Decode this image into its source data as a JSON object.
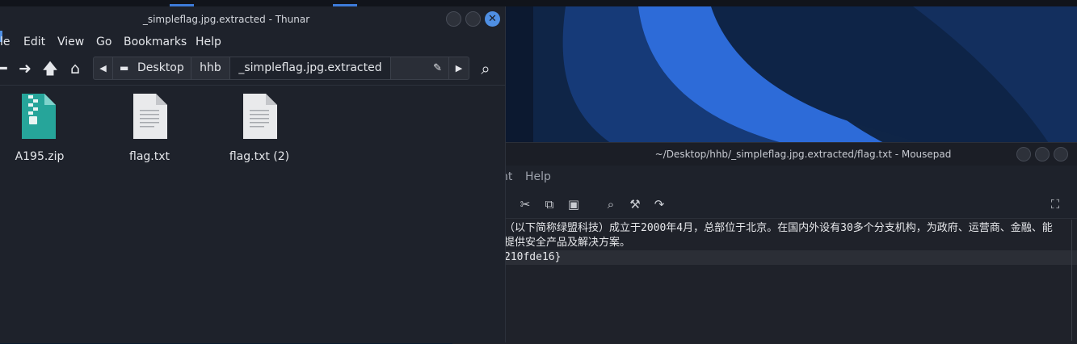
{
  "thunar": {
    "title": "_simpleflag.jpg.extracted - Thunar",
    "menu": [
      "le",
      "Edit",
      "View",
      "Go",
      "Bookmarks",
      "Help"
    ],
    "path": [
      "Desktop",
      "hhb",
      "_simpleflag.jpg.extracted"
    ],
    "files": [
      {
        "name": "A195.zip",
        "icon": "archive-zip-icon"
      },
      {
        "name": "flag.txt",
        "icon": "text-file-icon"
      },
      {
        "name": "flag.txt (2)",
        "icon": "text-file-icon"
      }
    ]
  },
  "mousepad": {
    "title": "~/Desktop/hhb/_simpleflag.jpg.extracted/flag.txt - Mousepad",
    "menu": [
      "nt",
      "Help"
    ],
    "lines": [
      "（以下简称绿盟科技）成立于2000年4月，总部位于北京。在国内外设有30多个分支机构，为政府、运营商、金融、能",
      "提供安全产品及解决方案。",
      "210fde16}"
    ]
  },
  "colors": {
    "accent": "#4f8fe3",
    "window_bg": "#1e222b",
    "wallpaper_dark": "#0d1b2e",
    "wallpaper_blue": "#2f6fdc"
  }
}
